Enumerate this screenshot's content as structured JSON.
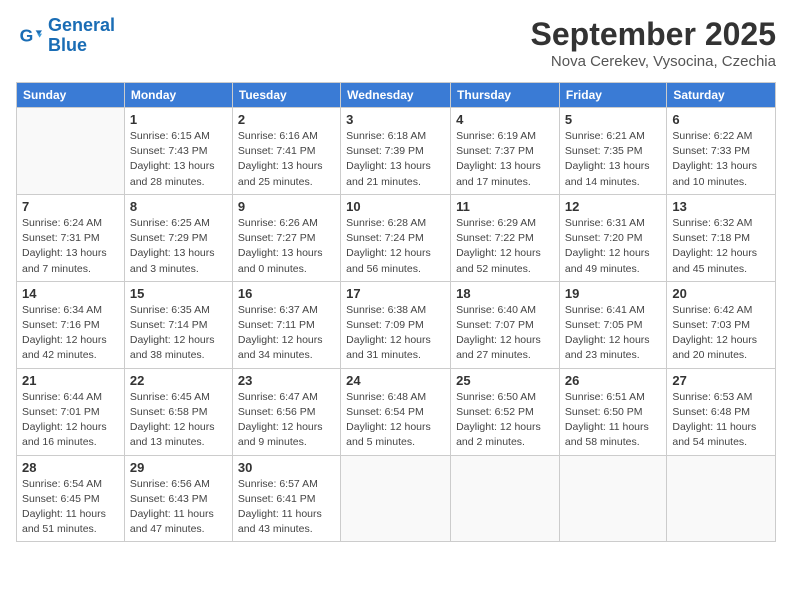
{
  "logo": {
    "line1": "General",
    "line2": "Blue"
  },
  "title": "September 2025",
  "subtitle": "Nova Cerekev, Vysocina, Czechia",
  "weekdays": [
    "Sunday",
    "Monday",
    "Tuesday",
    "Wednesday",
    "Thursday",
    "Friday",
    "Saturday"
  ],
  "weeks": [
    [
      {
        "day": "",
        "info": ""
      },
      {
        "day": "1",
        "info": "Sunrise: 6:15 AM\nSunset: 7:43 PM\nDaylight: 13 hours\nand 28 minutes."
      },
      {
        "day": "2",
        "info": "Sunrise: 6:16 AM\nSunset: 7:41 PM\nDaylight: 13 hours\nand 25 minutes."
      },
      {
        "day": "3",
        "info": "Sunrise: 6:18 AM\nSunset: 7:39 PM\nDaylight: 13 hours\nand 21 minutes."
      },
      {
        "day": "4",
        "info": "Sunrise: 6:19 AM\nSunset: 7:37 PM\nDaylight: 13 hours\nand 17 minutes."
      },
      {
        "day": "5",
        "info": "Sunrise: 6:21 AM\nSunset: 7:35 PM\nDaylight: 13 hours\nand 14 minutes."
      },
      {
        "day": "6",
        "info": "Sunrise: 6:22 AM\nSunset: 7:33 PM\nDaylight: 13 hours\nand 10 minutes."
      }
    ],
    [
      {
        "day": "7",
        "info": "Sunrise: 6:24 AM\nSunset: 7:31 PM\nDaylight: 13 hours\nand 7 minutes."
      },
      {
        "day": "8",
        "info": "Sunrise: 6:25 AM\nSunset: 7:29 PM\nDaylight: 13 hours\nand 3 minutes."
      },
      {
        "day": "9",
        "info": "Sunrise: 6:26 AM\nSunset: 7:27 PM\nDaylight: 13 hours\nand 0 minutes."
      },
      {
        "day": "10",
        "info": "Sunrise: 6:28 AM\nSunset: 7:24 PM\nDaylight: 12 hours\nand 56 minutes."
      },
      {
        "day": "11",
        "info": "Sunrise: 6:29 AM\nSunset: 7:22 PM\nDaylight: 12 hours\nand 52 minutes."
      },
      {
        "day": "12",
        "info": "Sunrise: 6:31 AM\nSunset: 7:20 PM\nDaylight: 12 hours\nand 49 minutes."
      },
      {
        "day": "13",
        "info": "Sunrise: 6:32 AM\nSunset: 7:18 PM\nDaylight: 12 hours\nand 45 minutes."
      }
    ],
    [
      {
        "day": "14",
        "info": "Sunrise: 6:34 AM\nSunset: 7:16 PM\nDaylight: 12 hours\nand 42 minutes."
      },
      {
        "day": "15",
        "info": "Sunrise: 6:35 AM\nSunset: 7:14 PM\nDaylight: 12 hours\nand 38 minutes."
      },
      {
        "day": "16",
        "info": "Sunrise: 6:37 AM\nSunset: 7:11 PM\nDaylight: 12 hours\nand 34 minutes."
      },
      {
        "day": "17",
        "info": "Sunrise: 6:38 AM\nSunset: 7:09 PM\nDaylight: 12 hours\nand 31 minutes."
      },
      {
        "day": "18",
        "info": "Sunrise: 6:40 AM\nSunset: 7:07 PM\nDaylight: 12 hours\nand 27 minutes."
      },
      {
        "day": "19",
        "info": "Sunrise: 6:41 AM\nSunset: 7:05 PM\nDaylight: 12 hours\nand 23 minutes."
      },
      {
        "day": "20",
        "info": "Sunrise: 6:42 AM\nSunset: 7:03 PM\nDaylight: 12 hours\nand 20 minutes."
      }
    ],
    [
      {
        "day": "21",
        "info": "Sunrise: 6:44 AM\nSunset: 7:01 PM\nDaylight: 12 hours\nand 16 minutes."
      },
      {
        "day": "22",
        "info": "Sunrise: 6:45 AM\nSunset: 6:58 PM\nDaylight: 12 hours\nand 13 minutes."
      },
      {
        "day": "23",
        "info": "Sunrise: 6:47 AM\nSunset: 6:56 PM\nDaylight: 12 hours\nand 9 minutes."
      },
      {
        "day": "24",
        "info": "Sunrise: 6:48 AM\nSunset: 6:54 PM\nDaylight: 12 hours\nand 5 minutes."
      },
      {
        "day": "25",
        "info": "Sunrise: 6:50 AM\nSunset: 6:52 PM\nDaylight: 12 hours\nand 2 minutes."
      },
      {
        "day": "26",
        "info": "Sunrise: 6:51 AM\nSunset: 6:50 PM\nDaylight: 11 hours\nand 58 minutes."
      },
      {
        "day": "27",
        "info": "Sunrise: 6:53 AM\nSunset: 6:48 PM\nDaylight: 11 hours\nand 54 minutes."
      }
    ],
    [
      {
        "day": "28",
        "info": "Sunrise: 6:54 AM\nSunset: 6:45 PM\nDaylight: 11 hours\nand 51 minutes."
      },
      {
        "day": "29",
        "info": "Sunrise: 6:56 AM\nSunset: 6:43 PM\nDaylight: 11 hours\nand 47 minutes."
      },
      {
        "day": "30",
        "info": "Sunrise: 6:57 AM\nSunset: 6:41 PM\nDaylight: 11 hours\nand 43 minutes."
      },
      {
        "day": "",
        "info": ""
      },
      {
        "day": "",
        "info": ""
      },
      {
        "day": "",
        "info": ""
      },
      {
        "day": "",
        "info": ""
      }
    ]
  ]
}
